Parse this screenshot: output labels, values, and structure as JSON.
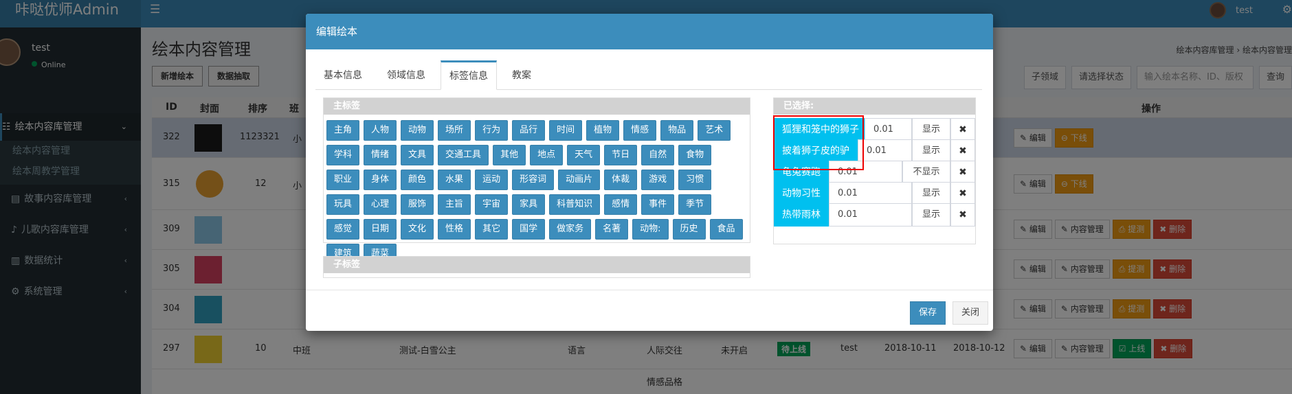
{
  "app": {
    "logo": "咔哒优师",
    "logo_suffix": "Admin",
    "top_user": "test"
  },
  "user": {
    "name": "test",
    "status": "Online"
  },
  "sidebar": {
    "items": [
      {
        "label": "绘本内容库管理"
      },
      {
        "label": "故事内容库管理"
      },
      {
        "label": "儿歌内容库管理"
      },
      {
        "label": "数据统计"
      },
      {
        "label": "系统管理"
      }
    ],
    "sub": [
      {
        "label": "绘本内容管理"
      },
      {
        "label": "绘本周教学管理"
      }
    ]
  },
  "page": {
    "title": "绘本内容管理",
    "crumb1": "绘本内容库管理",
    "crumb2": "绘本内容管理",
    "btn_add": "新增绘本",
    "btn_pick": "数据抽取",
    "filter_domain": "子领域",
    "filter_status": "请选择状态",
    "search_placeholder": "输入绘本名称、ID、版权",
    "search_btn": "查询"
  },
  "table": {
    "headers": {
      "id": "ID",
      "cover": "封面",
      "order": "排序",
      "cls": "班",
      "ops": "操作"
    },
    "rows": [
      {
        "id": "322",
        "order": "1123321",
        "cls": "小"
      },
      {
        "id": "315",
        "order": "12",
        "cls": "小"
      },
      {
        "id": "309"
      },
      {
        "id": "305"
      },
      {
        "id": "304"
      },
      {
        "id": "297",
        "order": "10",
        "cls": "中班",
        "name": "测试-白雪公主",
        "domain": "语言",
        "sub": "人际交往",
        "start": "未开启",
        "status": "待上线",
        "author": "test",
        "d1": "2018-10-11",
        "d2": "2018-10-12"
      },
      {
        "sub": "情感品格"
      }
    ],
    "btn_edit": "编辑",
    "btn_down": "下线",
    "btn_content": "内容管理",
    "btn_review": "提测",
    "btn_delete": "删除",
    "btn_up": "上线"
  },
  "modal": {
    "title": "编辑绘本",
    "tabs": [
      {
        "label": "基本信息"
      },
      {
        "label": "领域信息"
      },
      {
        "label": "标签信息"
      },
      {
        "label": "教案"
      }
    ],
    "main_tags_title": "主标签",
    "sub_tags_title": "子标签",
    "selected_title": "已选择:",
    "tags": [
      "主角",
      "人物",
      "动物",
      "场所",
      "行为",
      "品行",
      "时间",
      "植物",
      "情感",
      "物品",
      "艺术",
      "学科",
      "情绪",
      "文具",
      "交通工具",
      "其他",
      "地点",
      "天气",
      "节日",
      "自然",
      "食物",
      "职业",
      "身体",
      "颜色",
      "水果",
      "运动",
      "形容词",
      "动画片",
      "体裁",
      "游戏",
      "习惯",
      "玩具",
      "心理",
      "服饰",
      "主旨",
      "宇宙",
      "家具",
      "科普知识",
      "感情",
      "事件",
      "季节",
      "感觉",
      "日期",
      "文化",
      "性格",
      "其它",
      "国学",
      "做家务",
      "名著",
      "动物:",
      "历史",
      "食品",
      "建筑",
      "蔬菜"
    ],
    "selected": [
      {
        "label": "狐狸和笼中的狮子",
        "value": "0.01",
        "status": "显示"
      },
      {
        "label": "披着狮子皮的驴",
        "value": "0.01",
        "status": "显示"
      },
      {
        "label": "龟兔赛跑",
        "value": "0.01",
        "status": "不显示"
      },
      {
        "label": "动物习性",
        "value": "0.01",
        "status": "显示"
      },
      {
        "label": "热带雨林",
        "value": "0.01",
        "status": "显示"
      }
    ],
    "save": "保存",
    "close": "关闭"
  }
}
